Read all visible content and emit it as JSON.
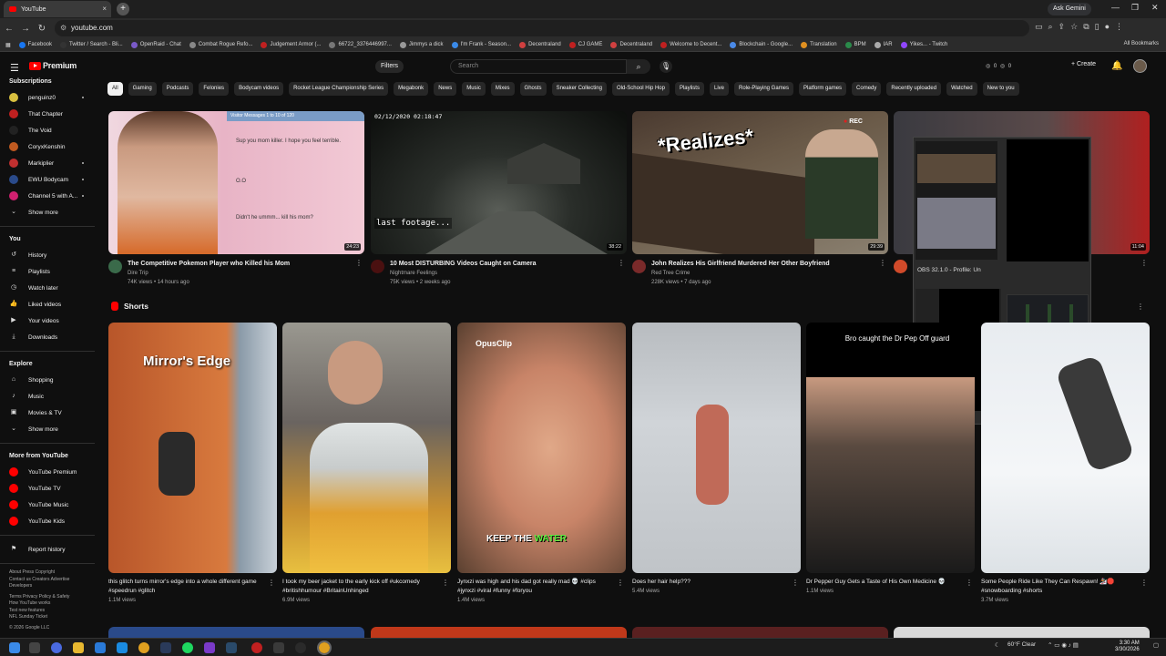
{
  "browser": {
    "tab_title": "YouTube",
    "tab_close": "×",
    "new_tab": "+",
    "ask_gemini": "Ask Gemini",
    "url": "youtube.com",
    "bookmarks": [
      "Facebook",
      "Twitter / Search - Bli...",
      "OpenRaid - Chat",
      "Combat Rogue Refo...",
      "Judgement Armor (...",
      "66722_3376446997...",
      "Jimmys a dick",
      "I'm Frank - Season...",
      "Decentraland",
      "CJ GAME",
      "Decentraland",
      "Welcome to Decent...",
      "Blockchain - Google...",
      "Translation",
      "BPM",
      "IAR",
      "Yikes... - Twitch"
    ],
    "all_bookmarks": "All Bookmarks"
  },
  "yt_header": {
    "logo": "Premium",
    "filters": "Filters",
    "search_placeholder": "Search",
    "stats": "◎ 0 ◎ 0",
    "create": "+ Create"
  },
  "sidebar": {
    "subscriptions_title": "Subscriptions",
    "subscriptions": [
      {
        "name": "penguinz0",
        "dot": true
      },
      {
        "name": "That Chapter",
        "dot": false
      },
      {
        "name": "The Void",
        "dot": false
      },
      {
        "name": "CoryxKenshin",
        "dot": false
      },
      {
        "name": "Markiplier",
        "dot": true
      },
      {
        "name": "EWU Bodycam",
        "dot": true
      },
      {
        "name": "Channel 5 with A...",
        "dot": true
      }
    ],
    "show_more": "Show more",
    "you_title": "You",
    "you_items": [
      "History",
      "Playlists",
      "Watch later",
      "Liked videos",
      "Your videos",
      "Downloads"
    ],
    "explore_title": "Explore",
    "explore_items": [
      "Shopping",
      "Music",
      "Movies & TV"
    ],
    "show_more2": "Show more",
    "more_title": "More from YouTube",
    "more_items": [
      "YouTube Premium",
      "YouTube TV",
      "YouTube Music",
      "YouTube Kids"
    ],
    "report": "Report history",
    "footer": [
      "About  Press  Copyright",
      "Contact us  Creators  Advertise",
      "Developers",
      "",
      "Terms  Privacy  Policy & Safety",
      "How YouTube works",
      "Test new features",
      "NFL Sunday Ticket",
      "",
      "© 2026 Google LLC"
    ]
  },
  "chips": [
    "All",
    "Gaming",
    "Podcasts",
    "Felonies",
    "Bodycam videos",
    "Rocket League Championship Series",
    "Megabonk",
    "News",
    "Music",
    "Mixes",
    "Ghosts",
    "Sneaker Collecting",
    "Old-School Hip Hop",
    "Playlists",
    "Live",
    "Role-Playing Games",
    "Platform games",
    "Comedy",
    "Recently uploaded",
    "Watched",
    "New to you"
  ],
  "videos": [
    {
      "title": "The Competitive Pokemon Player who Killed his Mom",
      "channel": "Dire Trip",
      "stats": "74K views • 14 hours ago",
      "duration": "24:23",
      "thumb_text": "Visitor Messages 1 to 10 of 120",
      "thumb_lines": [
        "Sup you mom killer. I hope you feel terrible.",
        "O.O",
        "Didn't he ummm... kill his mom?"
      ]
    },
    {
      "title": "10 Most DISTURBING Videos Caught on Camera",
      "channel": "Nightmare Feelings",
      "stats": "75K views • 2 weeks ago",
      "duration": "38:22",
      "thumb_text": "02/12/2020 02:18:47",
      "thumb_caption": "last footage..."
    },
    {
      "title": "John Realizes His Girlfriend Murdered Her Other Boyfriend",
      "channel": "Red Tree Crime",
      "stats": "228K views • 7 days ago",
      "duration": "29:39",
      "thumb_text": "*Realizes*",
      "rec": "REC"
    },
    {
      "title": "",
      "channel": "",
      "stats": "",
      "duration": "11:04"
    }
  ],
  "obs": {
    "title": "OBS 32.1.0 - Profile: Un"
  },
  "shorts_title": "Shorts",
  "shorts": [
    {
      "title": "this glitch turns mirror's edge into a whole different game #speedrun #glitch",
      "views": "1.1M views",
      "overlay": "Mirror's Edge"
    },
    {
      "title": "I took my beer jacket to the early kick off #ukcomedy #britishhumour #BritainUnhinged",
      "views": "6.9M views"
    },
    {
      "title": "Jynxzi was high and his dad got really mad 💀 #clips #jynxzi #viral #funny #foryou",
      "views": "1.4M views",
      "overlay": "OpusClip",
      "caption_a": "KEEP THE ",
      "caption_b": "WATER"
    },
    {
      "title": "Does her hair help???",
      "views": "5.4M views"
    },
    {
      "title": "Dr Pepper Guy Gets a Taste of His Own Medicine 💀",
      "views": "1.1M views",
      "overlay": "Bro caught the Dr Pep Off guard"
    },
    {
      "title": "Some People Ride Like They Can Respawn! 🏂🛑 #snowboarding #shorts",
      "views": "3.7M views"
    }
  ],
  "taskbar": {
    "weather": "60°F  Clear",
    "time": "3:30 AM",
    "date": "3/30/2026"
  }
}
